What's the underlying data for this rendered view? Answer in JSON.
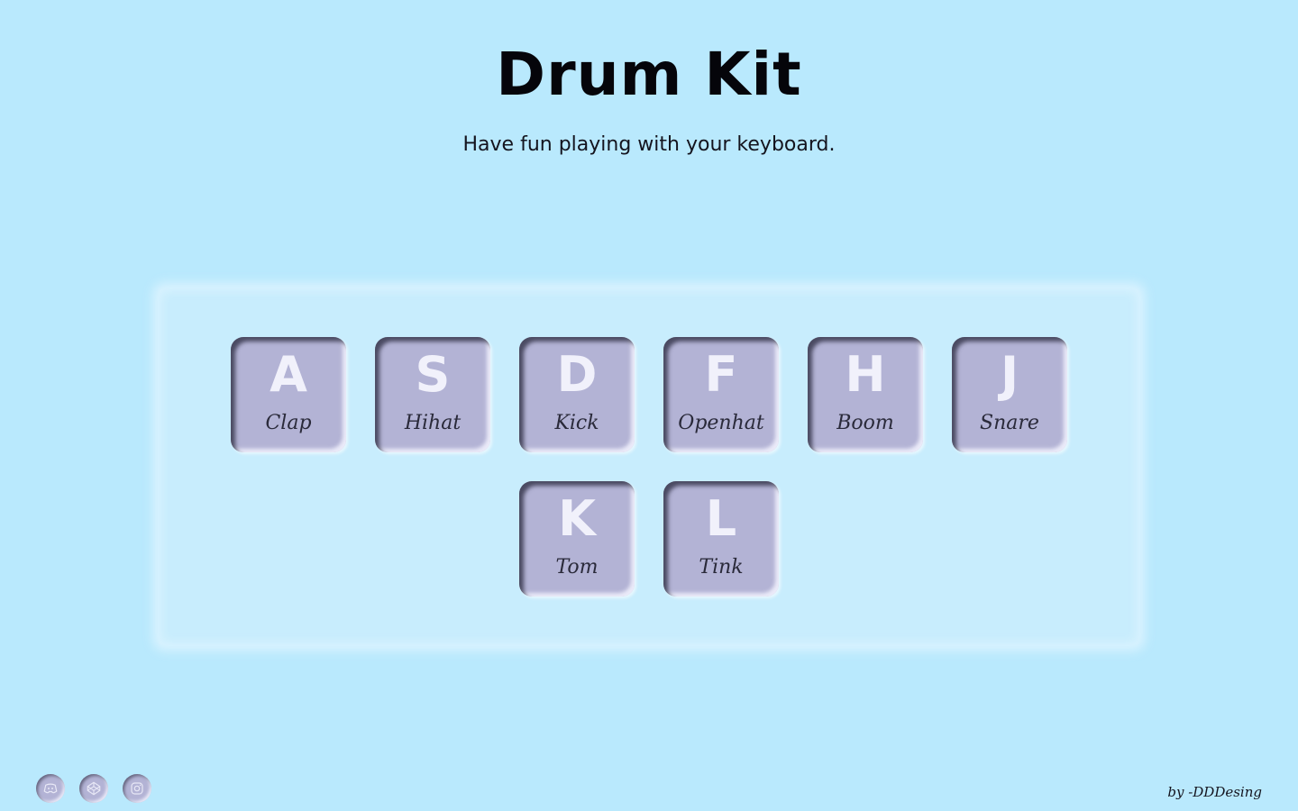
{
  "header": {
    "title": "Drum Kit",
    "subtitle": "Have fun playing with your keyboard."
  },
  "keys": [
    {
      "letter": "A",
      "sound": "Clap"
    },
    {
      "letter": "S",
      "sound": "Hihat"
    },
    {
      "letter": "D",
      "sound": "Kick"
    },
    {
      "letter": "F",
      "sound": "Openhat"
    },
    {
      "letter": "H",
      "sound": "Boom"
    },
    {
      "letter": "J",
      "sound": "Snare"
    },
    {
      "letter": "K",
      "sound": "Tom"
    },
    {
      "letter": "L",
      "sound": "Tink"
    }
  ],
  "footer": {
    "social_icons": [
      "discord-icon",
      "codepen-icon",
      "instagram-icon"
    ],
    "credit": "by -DDDesing"
  },
  "colors": {
    "background": "#b9e9fd",
    "panel": "#c8edfd",
    "key": "#b3b3d5",
    "key_letter": "#f1f1fb"
  }
}
